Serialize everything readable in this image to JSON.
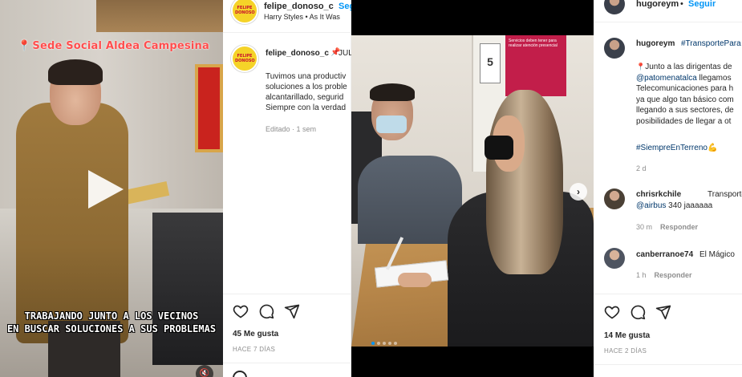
{
  "reel": {
    "location": "Sede Social Aldea Campesina",
    "caption_line1": "TRABAJANDO JUNTO A LOS VECINOS",
    "caption_line2": "EN BUSCAR SOLUCIONES A SUS PROBLEMAS"
  },
  "post1": {
    "username": "felipe_donoso_c",
    "follow_label": "Seguir",
    "song": "Harry Styles • As It Was",
    "comment_user": "felipe_donoso_c",
    "comment_month": "JUL",
    "comment_lines": [
      "Tuvimos una productiv",
      "soluciones a los proble",
      "alcantarillado, segurid",
      "Siempre con la verdad"
    ],
    "comment_meta": "Editado · 1 sem",
    "likes": "45 Me gusta",
    "time": "HACE 7 DÍAS"
  },
  "photo": {
    "sign_number": "5",
    "sign_text": "Servicios deben tener para realizar atención presencial",
    "slide_count": 5,
    "active_slide": 1
  },
  "post2": {
    "username": "hugoreym",
    "separator": "•",
    "follow_label": "Seguir",
    "caption_user": "hugoreym",
    "caption_tag": "#TransportePara",
    "caption_line1": "Junto a las dirigentas de",
    "caption_line2_link": "@patomenatalca",
    "caption_line2_rest": " llegamos",
    "caption_line3": "Telecomunicaciones para h",
    "caption_line4": "ya que algo tan básico com",
    "caption_line5": "llegando a sus sectores, de",
    "caption_line6": "posibilidades de llegar a ot",
    "hashtag": "#SiempreEnTerreno",
    "caption_time": "2 d",
    "reply1_user": "chrisrkchile",
    "reply1_text": "Transporte par",
    "reply1_link": "@airbus",
    "reply1_rest": " 340 jaaaaaa",
    "reply1_time": "30 m",
    "reply1_action": "Responder",
    "reply2_user": "canberranoe74",
    "reply2_text": "El Mágico",
    "reply2_time": "1 h",
    "reply2_action": "Responder",
    "likes": "14 Me gusta",
    "time": "HACE 2 DÍAS"
  },
  "colors": {
    "link_blue": "#0095f6",
    "hashtag_blue": "#00376b",
    "muted_gray": "#8e8e8e",
    "location_red": "#ff4d4d"
  }
}
